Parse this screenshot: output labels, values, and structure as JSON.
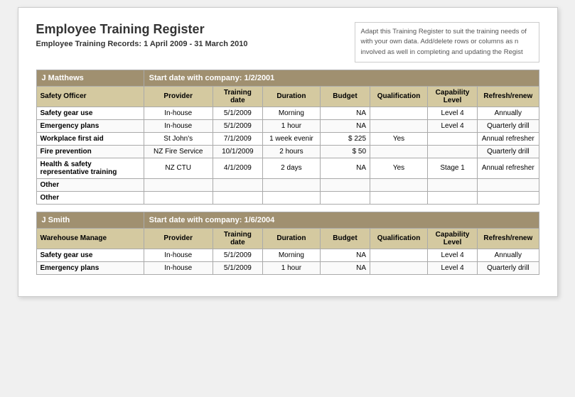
{
  "title": "Employee Training Register",
  "subtitle": "Employee Training Records: 1 April 2009 - 31 March 2010",
  "info_box": "Adapt this Training Register to suit the training needs of with your own data. Add/delete rows or columns as n involved as well in completing and updating the Regist",
  "columns": {
    "role": "",
    "provider": "Provider",
    "training_date": "Training date",
    "duration": "Duration",
    "budget": "Budget",
    "qualification": "Qualification",
    "capability_level": "Capability Level",
    "refresh": "Refresh/renew"
  },
  "employees": [
    {
      "name": "J Matthews",
      "start_date": "Start date with company: 1/2/2001",
      "role": "Safety Officer",
      "trainings": [
        {
          "name": "Safety gear use",
          "provider": "In-house",
          "date": "5/1/2009",
          "duration": "Morning",
          "budget": "NA",
          "qualification": "",
          "capability": "Level 4",
          "refresh": "Annually"
        },
        {
          "name": "Emergency plans",
          "provider": "In-house",
          "date": "5/1/2009",
          "duration": "1 hour",
          "budget": "NA",
          "qualification": "",
          "capability": "Level 4",
          "refresh": "Quarterly drill"
        },
        {
          "name": "Workplace first aid",
          "provider": "St John's",
          "date": "7/1/2009",
          "duration": "1 week evenir",
          "budget": "$ 225",
          "qualification": "Yes",
          "capability": "",
          "refresh": "Annual refresher"
        },
        {
          "name": "Fire prevention",
          "provider": "NZ Fire Service",
          "date": "10/1/2009",
          "duration": "2 hours",
          "budget": "$  50",
          "qualification": "",
          "capability": "",
          "refresh": "Quarterly drill"
        },
        {
          "name": "Health & safety representative training",
          "provider": "NZ CTU",
          "date": "4/1/2009",
          "duration": "2 days",
          "budget": "NA",
          "qualification": "Yes",
          "capability": "Stage 1",
          "refresh": "Annual refresher"
        },
        {
          "name": "Other",
          "provider": "",
          "date": "",
          "duration": "",
          "budget": "",
          "qualification": "",
          "capability": "",
          "refresh": ""
        },
        {
          "name": "Other",
          "provider": "",
          "date": "",
          "duration": "",
          "budget": "",
          "qualification": "",
          "capability": "",
          "refresh": ""
        }
      ]
    },
    {
      "name": "J Smith",
      "start_date": "Start date with company: 1/6/2004",
      "role": "Warehouse Manage",
      "trainings": [
        {
          "name": "Safety gear use",
          "provider": "In-house",
          "date": "5/1/2009",
          "duration": "Morning",
          "budget": "NA",
          "qualification": "",
          "capability": "Level 4",
          "refresh": "Annually"
        },
        {
          "name": "Emergency plans",
          "provider": "In-house",
          "date": "5/1/2009",
          "duration": "1 hour",
          "budget": "NA",
          "qualification": "",
          "capability": "Level 4",
          "refresh": "Quarterly drill"
        }
      ]
    }
  ]
}
